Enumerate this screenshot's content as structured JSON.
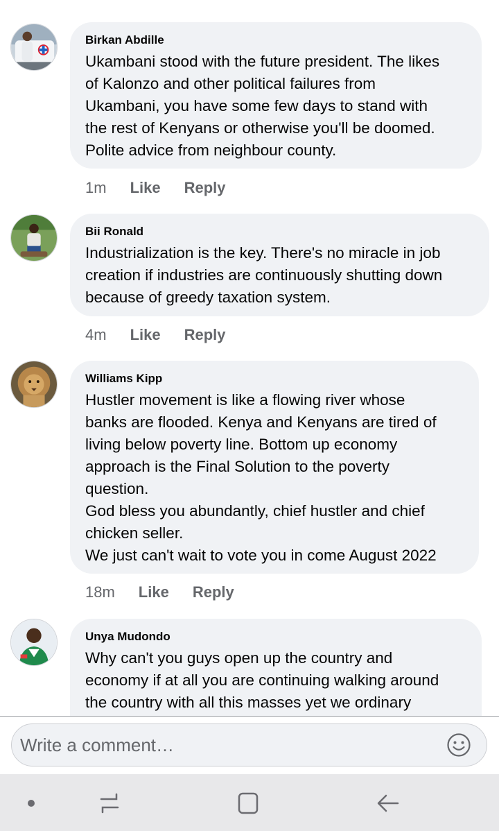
{
  "comments": [
    {
      "author": "Birkan Abdille",
      "text": "Ukambani stood with the future president. The likes\nof Kalonzo and other political failures from\nUkambani, you have some few days to stand with\nthe rest of Kenyans or otherwise you'll be doomed.\nPolite advice from neighbour county.",
      "time": "1m",
      "like": "Like",
      "reply": "Reply"
    },
    {
      "author": "Bii Ronald",
      "text": "Industrialization is the key. There's no miracle in job\ncreation if industries are continuously shutting down\nbecause of greedy taxation system.",
      "time": "4m",
      "like": "Like",
      "reply": "Reply"
    },
    {
      "author": "Williams Kipp",
      "text": "Hustler movement is like a flowing river whose\nbanks are flooded. Kenya and Kenyans are tired of\nliving below poverty line. Bottom up economy\napproach is the Final Solution to the poverty\nquestion.\nGod bless you abundantly, chief hustler and chief\nchicken seller.\nWe just can't wait to vote you in come August 2022",
      "time": "18m",
      "like": "Like",
      "reply": "Reply"
    },
    {
      "author": "Unya Mudondo",
      "text": "Why can't you guys open up the country and\neconomy if at all you are continuing walking around\nthe country with all this masses yet we ordinary\nKenyans are suffering with this endless curfew",
      "time": "",
      "like": "",
      "reply": ""
    }
  ],
  "composer": {
    "placeholder": "Write a comment…"
  },
  "icons": {
    "emoji": "smiley-face-icon",
    "nav_dot": "dot-icon",
    "nav_recents": "recents-icon",
    "nav_home": "home-square-icon",
    "nav_back": "back-arrow-icon"
  },
  "colors": {
    "bubble": "#f0f2f5",
    "meta_text": "#65676b",
    "navbar": "#e8e8ea"
  }
}
